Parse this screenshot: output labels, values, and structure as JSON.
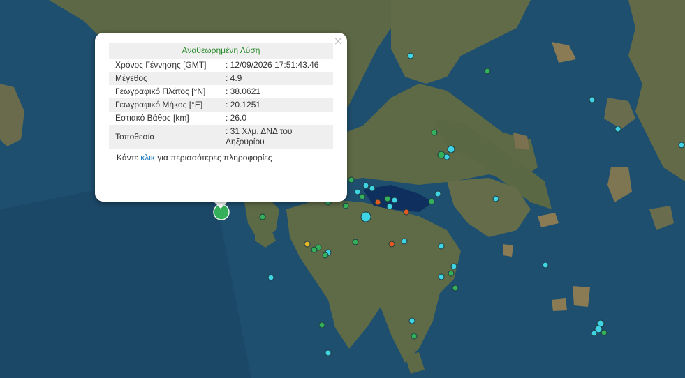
{
  "popup": {
    "title": "Αναθεωρημένη Λύση",
    "close_symbol": "×",
    "rows": [
      {
        "label": "Χρόνος Γέννησης [GMT]",
        "value": ": 12/09/2026 17:51:43.46"
      },
      {
        "label": "Μέγεθος",
        "value": ": 4.9"
      },
      {
        "label": "Γεωγραφικό Πλάτος [°N]",
        "value": ": 38.0621"
      },
      {
        "label": "Γεωγραφικό Μήκος [°E]",
        "value": ": 20.1251"
      },
      {
        "label": "Εστιακό Βάθος [km]",
        "value": ": 26.0"
      },
      {
        "label": "Τοποθεσία",
        "value": ": 31 Χλμ. ΔΝΔ του Ληξουρίου"
      }
    ],
    "more_before": "Κάντε ",
    "more_link": "κλικ",
    "more_after": " για περισσότερες πληροφορίες"
  },
  "colors": {
    "sea": "#1f4f6e",
    "land": "#5f6b49",
    "marker_cyan": "#3fd3e4",
    "marker_green": "#34b05a",
    "marker_orange": "#e05a22",
    "marker_yellow": "#e6b62a",
    "title_green": "#2e8b2e"
  }
}
